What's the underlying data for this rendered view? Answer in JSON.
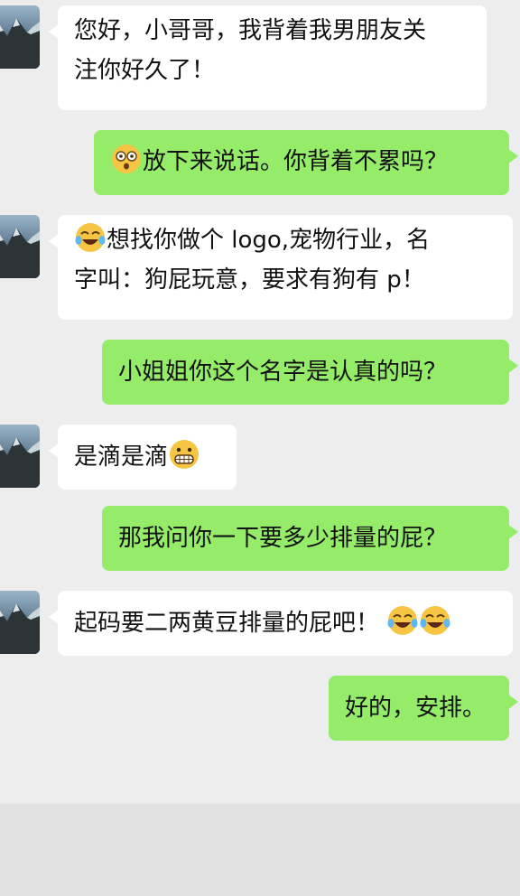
{
  "colors": {
    "background": "#ededed",
    "incoming_bubble": "#ffffff",
    "outgoing_bubble": "#95ec69"
  },
  "messages": [
    {
      "from": "them",
      "lines": [
        "您好，小哥哥，我背着我男朋友关",
        "注你好久了！"
      ]
    },
    {
      "from": "me",
      "text": "放下来说话。你背着不累吗？",
      "emoji": "dizzy-face-emoji"
    },
    {
      "from": "them",
      "line1": "想找你做个 logo,宠物行业，名",
      "line2": "字叫：狗屁玩意，要求有狗有 p！",
      "emoji": "tears-of-joy-emoji"
    },
    {
      "from": "me",
      "text": "小姐姐你这个名字是认真的吗？"
    },
    {
      "from": "them",
      "text": "是滴是滴",
      "emoji": "grimacing-face-emoji"
    },
    {
      "from": "me",
      "text": "那我问你一下要多少排量的屁？"
    },
    {
      "from": "them",
      "text": "起码要二两黄豆排量的屁吧！",
      "emoji": "tears-of-joy-emoji"
    },
    {
      "from": "me",
      "text": "好的，安排。"
    }
  ]
}
